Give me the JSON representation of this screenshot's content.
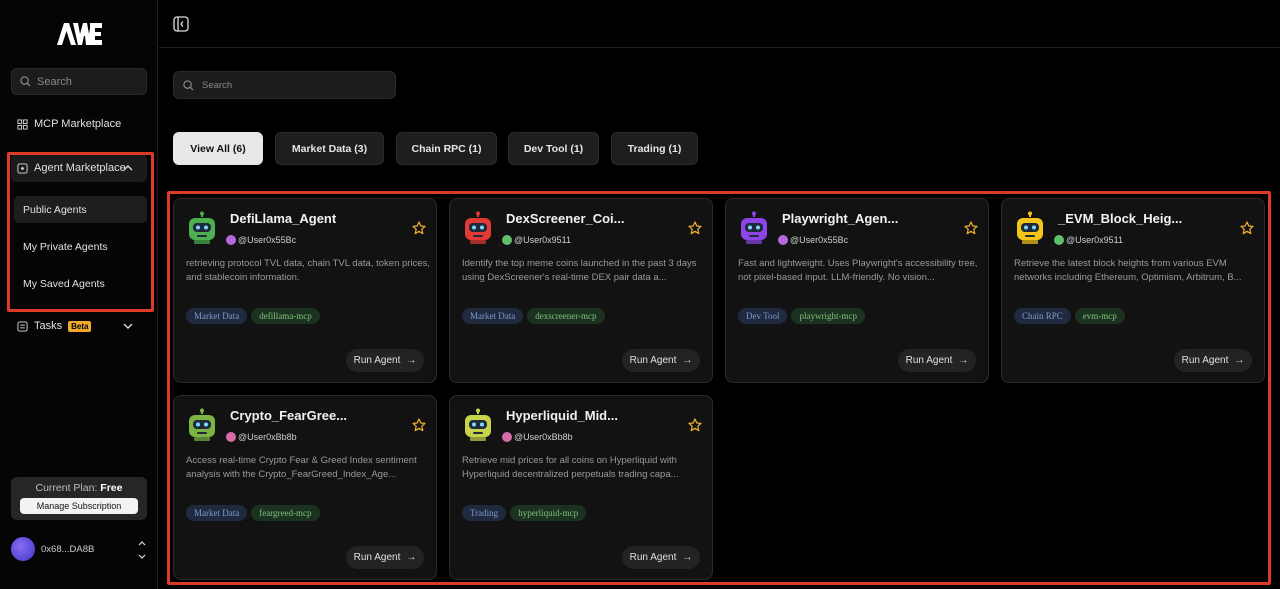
{
  "sidebar": {
    "logo_text": "AWE",
    "search_placeholder": "Search",
    "mcp_marketplace": "MCP Marketplace",
    "agent_marketplace": "Agent Marketplace",
    "sub_items": [
      "Public Agents",
      "My Private Agents",
      "My Saved Agents"
    ],
    "tasks": "Tasks",
    "beta_badge": "Beta",
    "plan_label": "Current Plan:",
    "plan_value": "Free",
    "manage_subscription": "Manage Subscription",
    "user_address": "0x68...DA8B"
  },
  "main": {
    "search_placeholder": "Search",
    "tabs": [
      {
        "label": "View All (6)",
        "active": true
      },
      {
        "label": "Market Data (3)",
        "active": false
      },
      {
        "label": "Chain RPC (1)",
        "active": false
      },
      {
        "label": "Dev Tool (1)",
        "active": false
      },
      {
        "label": "Trading (1)",
        "active": false
      }
    ],
    "run_label": "Run Agent",
    "agents": [
      {
        "name": "DefiLlama_Agent",
        "owner": "@User0x55Bc",
        "desc": "retrieving protocol TVL data, chain TVL data, token prices, and stablecoin information.",
        "category": "Market Data",
        "mcp": "defillama-mcp",
        "icon_color": "#4caf50"
      },
      {
        "name": "DexScreener_Coi...",
        "owner": "@User0x9511",
        "desc": "Identify the top meme coins launched in the past 3 days using DexScreener's real-time DEX pair data a...",
        "category": "Market Data",
        "mcp": "dexscreener-mcp",
        "icon_color": "#e53935"
      },
      {
        "name": "Playwright_Agen...",
        "owner": "@User0x55Bc",
        "desc": "Fast and lightweight. Uses Playwright's accessibility tree, not pixel-based input. LLM-friendly. No vision...",
        "category": "Dev Tool",
        "mcp": "playwright-mcp",
        "icon_color": "#8e44e8"
      },
      {
        "name": "_EVM_Block_Heig...",
        "owner": "@User0x9511",
        "desc": "Retrieve the latest block heights from various EVM networks including Ethereum, Optimism, Arbitrum, B...",
        "category": "Chain RPC",
        "mcp": "evm-mcp",
        "icon_color": "#f5c518"
      },
      {
        "name": "Crypto_FearGree...",
        "owner": "@User0xBb8b",
        "desc": "Access real-time Crypto Fear & Greed Index sentiment analysis with the Crypto_FearGreed_Index_Age...",
        "category": "Market Data",
        "mcp": "feargreed-mcp",
        "icon_color": "#7cb342"
      },
      {
        "name": "Hyperliquid_Mid...",
        "owner": "@User0xBb8b",
        "desc": "Retrieve mid prices for all coins on Hyperliquid with Hyperliquid decentralized perpetuals trading capa...",
        "category": "Trading",
        "mcp": "hyperliquid-mcp",
        "icon_color": "#c6d44a"
      }
    ]
  },
  "colors": {
    "accent_highlight": "#e03a26",
    "star": "#f2b233"
  }
}
